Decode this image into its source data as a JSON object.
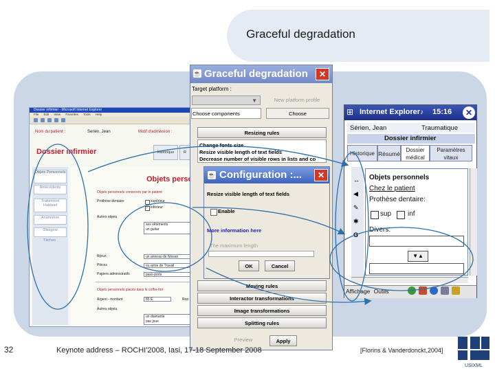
{
  "slide": {
    "title": "Graceful degradation",
    "slide_number": "32",
    "footer_text": "Keynote address – ROCHI'2008, Iasi, 17-18 September 2008",
    "citation": "[Florins & Vanderdonckt,2004]",
    "logo_text": "USIXML"
  },
  "ie_window": {
    "title": "Dossier infirmier - Microsoft Internet Explorer",
    "menu": "File Edit View Favorites Tools Help",
    "nom_label": "Nom du patient :",
    "nom_value": "Serien, Jean",
    "motif_label": "Motif d'admission :",
    "page_title": "Dossier infirmier",
    "tabs": [
      "Historique",
      "R"
    ],
    "nav": [
      "Objets Personnels",
      "Antécédents",
      "Traitement Habituel",
      "Anamnèse",
      "Glasgow",
      "Tâches"
    ],
    "section_title": "Objets perso",
    "subsection1": "Objets personnels conservés par le patient",
    "prothese_label": "Prothèse dentaire",
    "superieur": "supérieur",
    "inferieur": "inférieur",
    "autres_label": "Autres objets",
    "autres_values": [
      "ses vêtements",
      "un guitar"
    ],
    "bijoux_label": "Bijoux",
    "bijoux_value": "un anneau de Nissan",
    "pieces_label": "Pièces",
    "pieces_value": "ou arme de Travail",
    "papiers_label": "Papiers administratifs",
    "papiers_value": "pass-ports",
    "subsection2": "Objets personnels placés dans le coffre-fort",
    "argent_label": "Argent - montant",
    "argent_value": "85 E",
    "rep_label": "Rep",
    "autres2_label": "Autres objets",
    "autres2_values": [
      "un diamante",
      "pas joue"
    ]
  },
  "gd_dialog": {
    "title": "Graceful degradation",
    "target_label": "Target platform :",
    "new_platform": "New platform profile",
    "choose_components": "Choose components",
    "choose_button": "Choose",
    "resizing_rules": "Resizing rules",
    "options": [
      "Change fonts size",
      "Resize visible length of text fields",
      "Decrease number of visible rows in lists and co"
    ],
    "rules": [
      "Moving rules",
      "Interactor transformations",
      "Image transformations",
      "Splitting rules"
    ],
    "preview": "Preview",
    "apply": "Apply"
  },
  "config_dialog": {
    "title": "Configuration :...",
    "resize_label": "Resize visible length of text fields",
    "enable": "Enable",
    "more_info": "More information here",
    "max_length": "The maximum length",
    "ok": "OK",
    "cancel": "Cancel"
  },
  "ppc_window": {
    "title": "Internet Explorer",
    "time": "15:16",
    "patient": "Sérien, Jean",
    "motif": "Traumatique",
    "page_title": "Dossier infirmier",
    "tabs": [
      "Historique",
      "Résumé",
      "Dossier médical",
      "Paramètres vitaux"
    ],
    "objets": "Objets personnels",
    "chez": "Chez le patient",
    "prothese": "Prothèse dentaire:",
    "sup": "sup",
    "inf": "inf",
    "divers": "Divers:",
    "bottom": "Affichage Outils"
  }
}
